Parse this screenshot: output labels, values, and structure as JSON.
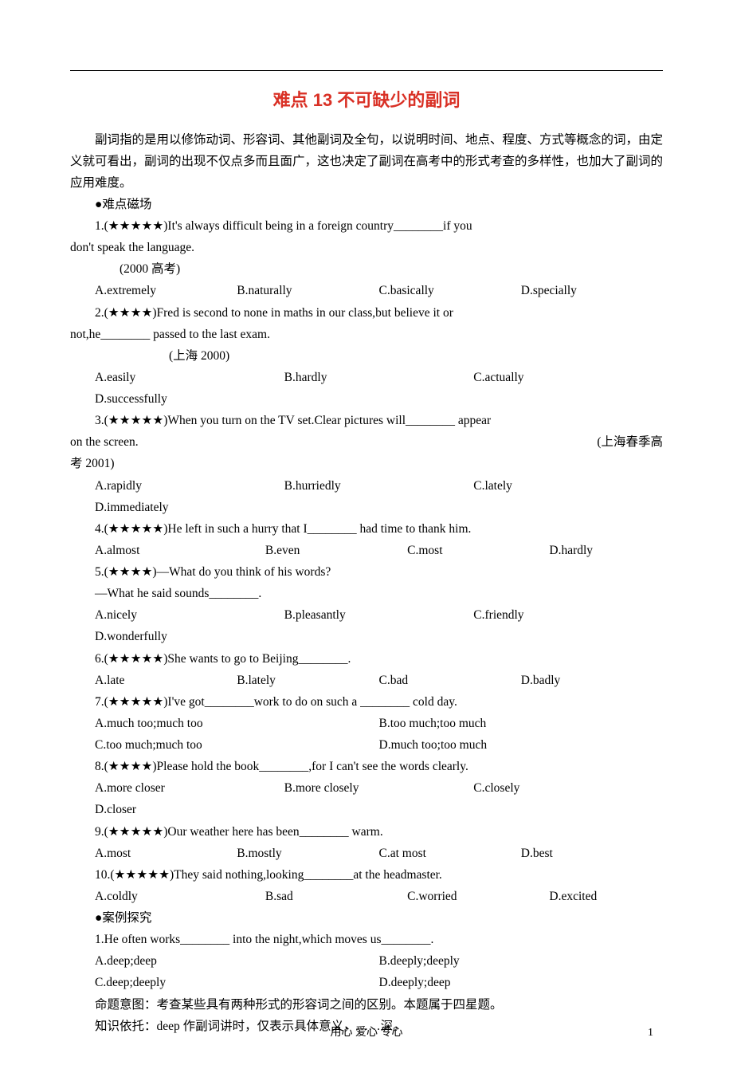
{
  "title": "难点 13  不可缺少的副词",
  "intro": "副词指的是用以修饰动词、形容词、其他副词及全句，以说明时间、地点、程度、方式等概念的词，由定义就可看出，副词的出现不仅点多而且面广，这也决定了副词在高考中的形式考查的多样性，也加大了副词的应用难度。",
  "sectionA": "●难点磁场",
  "q1": {
    "stem_a": "1.(★★★★★)It's always difficult being in a foreign country________if you",
    "stem_b": "don't speak the language.",
    "src": "(2000 高考)",
    "opts": [
      "A.extremely",
      "B.naturally",
      "C.basically",
      "D.specially"
    ]
  },
  "q2": {
    "stem_a": "2.(★★★★)Fred is second to none in maths in our class,but believe it or",
    "stem_b": "not,he________ passed to the last exam.",
    "src": "(上海 2000)",
    "opts": [
      "A.easily",
      "B.hardly",
      "C.actually",
      "D.successfully"
    ]
  },
  "q3": {
    "stem_a": "3.(★★★★★)When you turn on the TV set.Clear pictures will________ appear",
    "stem_b": "on the screen.",
    "src_inline": "(上海春季高",
    "src_cont": "考 2001)",
    "opts": [
      "A.rapidly",
      "B.hurriedly",
      "C.lately",
      "D.immediately"
    ]
  },
  "q4": {
    "stem": "4.(★★★★★)He left in such a hurry that I________ had time to thank him.",
    "opts": [
      "A.almost",
      "B.even",
      "C.most",
      "D.hardly"
    ]
  },
  "q5": {
    "stem_a": "5.(★★★★)—What do you think of his words?",
    "stem_b": "—What he said sounds________.",
    "opts": [
      "A.nicely",
      "B.pleasantly",
      "C.friendly",
      "D.wonderfully"
    ]
  },
  "q6": {
    "stem": "6.(★★★★★)She wants to go to Beijing________.",
    "opts": [
      "A.late",
      "B.lately",
      "C.bad",
      "D.badly"
    ]
  },
  "q7": {
    "stem": "7.(★★★★★)I've got________work to do on such a ________ cold day.",
    "opts": [
      "A.much too;much too",
      "B.too much;too much",
      "C.too much;much too",
      "D.much too;too much"
    ]
  },
  "q8": {
    "stem": "8.(★★★★)Please hold the book________,for I can't see the words clearly.",
    "opts": [
      "A.more closer",
      "B.more closely",
      "C.closely",
      "D.closer"
    ]
  },
  "q9": {
    "stem": "9.(★★★★★)Our weather here has been________ warm.",
    "opts": [
      "A.most",
      "B.mostly",
      "C.at most",
      "D.best"
    ]
  },
  "q10": {
    "stem": "10.(★★★★★)They said nothing,looking________at the headmaster.",
    "opts": [
      "A.coldly",
      "B.sad",
      "C.worried",
      "D.excited"
    ]
  },
  "sectionB": "●案例探究",
  "c1": {
    "stem": "1.He often works________ into the night,which moves us________.",
    "opts": [
      "A.deep;deep",
      "B.deeply;deeply",
      "C.deep;deeply",
      "D.deeply;deep"
    ],
    "intent": "命题意图：考查某些具有两种形式的形容词之间的区别。本题属于四星题。",
    "basis": "知识依托：deep 作副词讲时，仅表示具体意义，……深。"
  },
  "footer": "用心 爱心 专心",
  "pagenum": "1"
}
